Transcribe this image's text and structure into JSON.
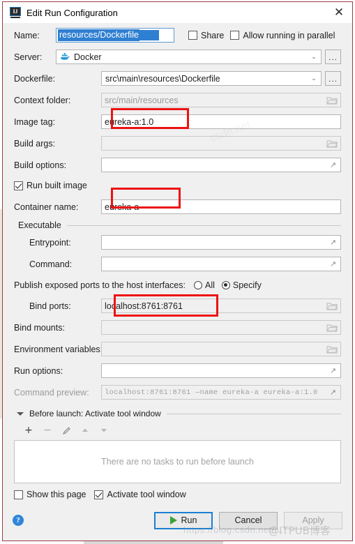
{
  "window": {
    "title": "Edit Run Configuration",
    "app_icon": "intellij-idea-icon",
    "close_label": "✕"
  },
  "form": {
    "name": {
      "label": "Name:",
      "value": "resources/Dockerfile",
      "selected": true
    },
    "share": {
      "label": "Share",
      "checked": false
    },
    "allow_parallel": {
      "label": "Allow running in parallel",
      "checked": false
    },
    "server": {
      "label": "Server:",
      "value": "Docker",
      "icon": "docker-whale-icon",
      "browse_label": "...",
      "chevron": "⌄"
    },
    "dockerfile": {
      "label": "Dockerfile:",
      "value": "src\\main\\resources\\Dockerfile",
      "browse_label": "...",
      "chevron": "⌄"
    },
    "context_folder": {
      "label": "Context folder:",
      "placeholder": "src/main/resources",
      "value": "",
      "disabled": true
    },
    "image_tag": {
      "label": "Image tag:",
      "value": "eureka-a:1.0",
      "highlighted": true
    },
    "build_args": {
      "label": "Build args:",
      "value": "",
      "disabled": true
    },
    "build_options": {
      "label": "Build options:",
      "value": ""
    },
    "run_built_image": {
      "label": "Run built image",
      "checked": true
    },
    "container_name": {
      "label": "Container name:",
      "value": "eureka-a",
      "highlighted": true
    },
    "executable_group": {
      "title": "Executable",
      "entrypoint": {
        "label": "Entrypoint:",
        "value": ""
      },
      "command": {
        "label": "Command:",
        "value": ""
      }
    },
    "publish_ports": {
      "label": "Publish exposed ports to the host interfaces:",
      "options": [
        {
          "label": "All",
          "selected": false
        },
        {
          "label": "Specify",
          "selected": true
        }
      ]
    },
    "bind_ports": {
      "label": "Bind ports:",
      "value": "localhost:8761:8761",
      "highlighted": true
    },
    "bind_mounts": {
      "label": "Bind mounts:",
      "value": "",
      "disabled": true
    },
    "environment_variables": {
      "label": "Environment variables:",
      "value": "",
      "disabled": true
    },
    "run_options": {
      "label": "Run options:",
      "value": ""
    },
    "command_preview": {
      "label": "Command preview:",
      "value": "localhost:8761:8761 —name eureka-a eureka-a:1.0",
      "disabled": true
    }
  },
  "before_launch": {
    "title": "Before launch: Activate tool window",
    "toolbar": [
      {
        "name": "add-task-button",
        "glyph": "+",
        "enabled": true
      },
      {
        "name": "remove-task-button",
        "glyph": "−",
        "enabled": false
      },
      {
        "name": "edit-task-button",
        "glyph": "✎",
        "enabled": false
      },
      {
        "name": "move-up-button",
        "glyph": "▲",
        "enabled": false
      },
      {
        "name": "move-down-button",
        "glyph": "▼",
        "enabled": false
      }
    ],
    "empty_text": "There are no tasks to run before launch",
    "show_this_page": {
      "label": "Show this page",
      "checked": false
    },
    "activate_tool_window": {
      "label": "Activate tool window",
      "checked": true
    }
  },
  "footer": {
    "help_label": "?",
    "run_label": "Run",
    "cancel_label": "Cancel",
    "apply_label": "Apply",
    "apply_enabled": false
  },
  "watermarks": {
    "url": "https://blog.csdn.net/...",
    "brand": "@ITPUB博客",
    "diagonal": "csdn.net"
  },
  "colors": {
    "annotation": "#ee1111",
    "selection": "#2f7fd1",
    "accent": "#1a7fd4",
    "window_border": "#9b3b45",
    "run_play": "#3fa037"
  }
}
